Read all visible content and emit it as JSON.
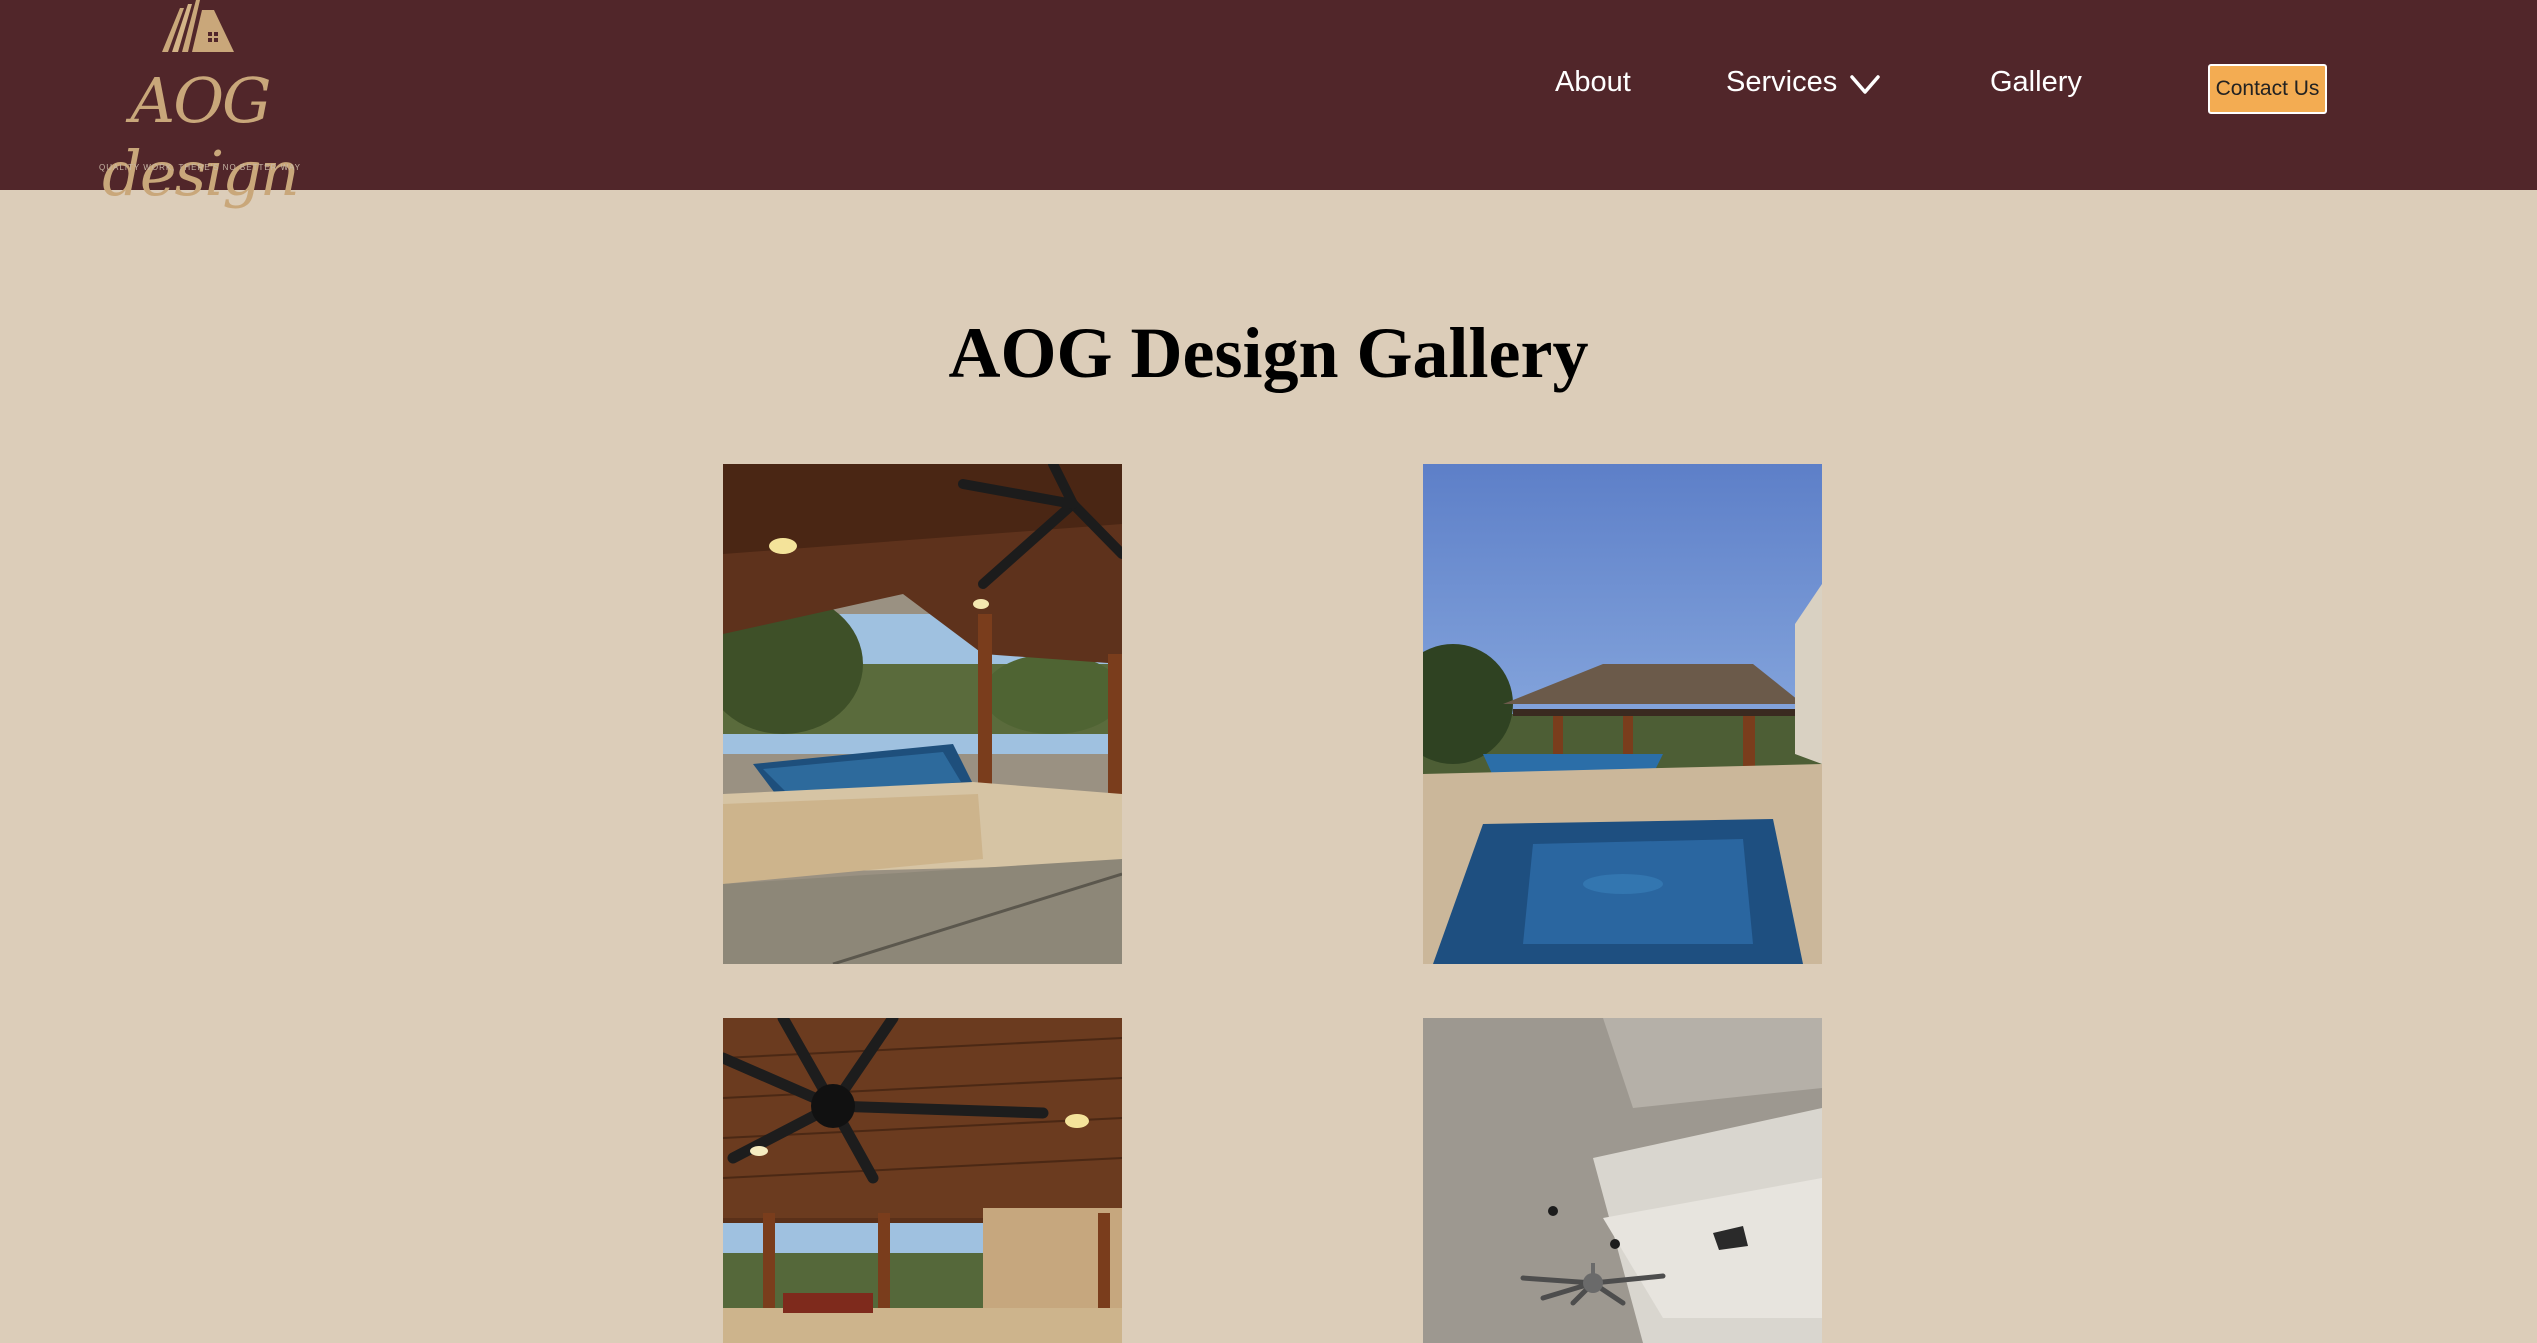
{
  "brand": {
    "logo_text": "AOG design",
    "tagline": "QUALITY WORK, THERE'S NO BETTER WAY"
  },
  "nav": {
    "about": "About",
    "services": "Services",
    "gallery": "Gallery",
    "contact": "Contact Us"
  },
  "page": {
    "title": "AOG Design Gallery"
  },
  "colors": {
    "header_bg": "#51262a",
    "page_bg": "#dccdb9",
    "button_bg": "#f3ac52"
  },
  "icons": {
    "services_dropdown": "chevron-down-icon"
  }
}
